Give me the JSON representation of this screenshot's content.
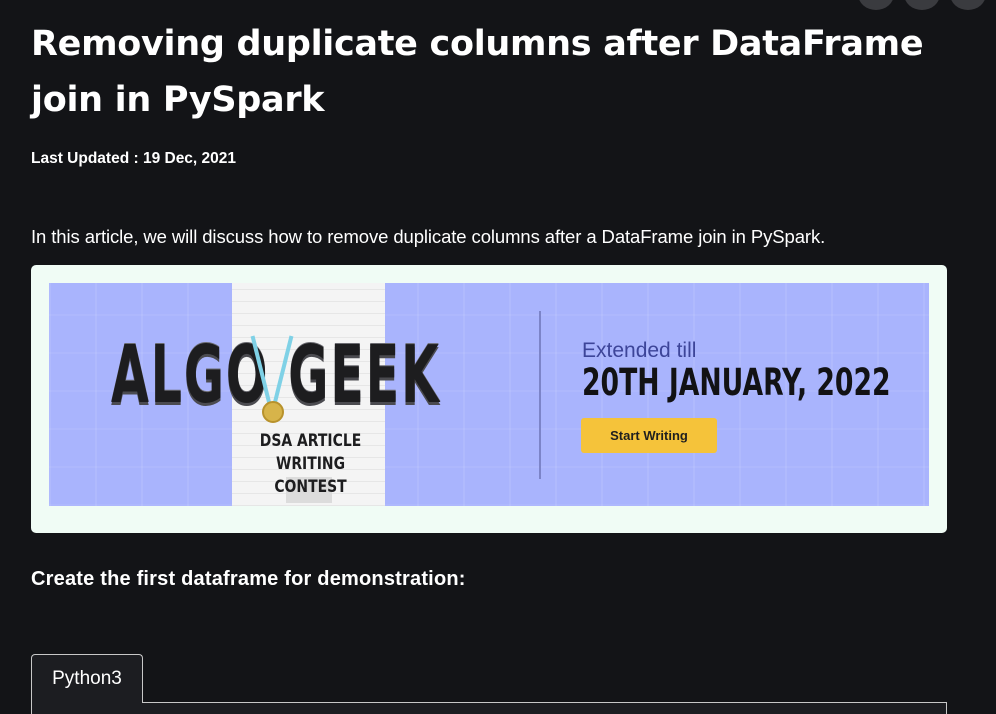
{
  "article": {
    "title": "Removing duplicate columns after DataFrame join in PySpark",
    "last_updated": "Last Updated : 19 Dec, 2021",
    "intro": "In this article, we will discuss how to remove duplicate columns after a DataFrame join in PySpark.",
    "section_heading": "Create the first dataframe for demonstration:"
  },
  "banner": {
    "headline": "ALGO GEEK",
    "subtitle_line1": "DSA ARTICLE",
    "subtitle_line2": "WRITING CONTEST",
    "extended_label": "Extended till",
    "deadline": "20TH JANUARY, 2022",
    "cta_label": "Start Writing",
    "colors": {
      "background": "#a9b4fd",
      "cta": "#f5c33a"
    }
  },
  "code_block": {
    "tab_label": "Python3"
  },
  "icons": [
    "circle-button-icon",
    "medal-icon"
  ]
}
